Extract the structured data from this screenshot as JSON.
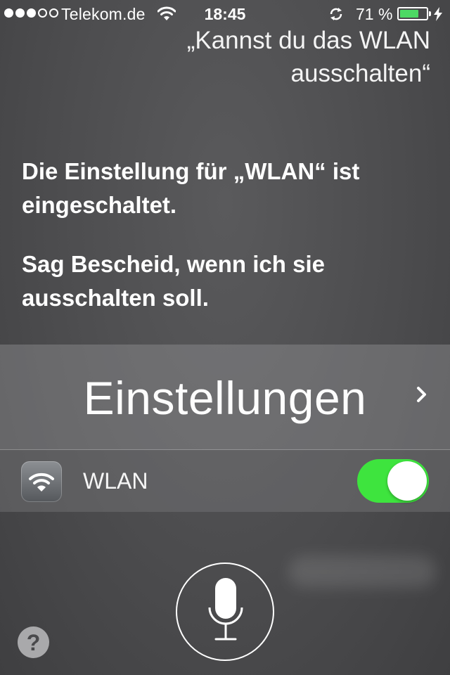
{
  "status_bar": {
    "carrier": "Telekom.de",
    "time": "18:45",
    "battery_percent": "71 %",
    "battery_level": 0.71,
    "signal_strength": 3,
    "signal_max": 5,
    "icons": [
      "wifi-icon",
      "sync-icon",
      "battery-icon",
      "charging-icon"
    ]
  },
  "query": {
    "text": "„Kannst du das WLAN ausschalten“"
  },
  "reply": {
    "line1": "Die Einstellung für „WLAN“ ist eingeschaltet.",
    "line2": "Sag Bescheid, wenn ich sie ausschalten soll."
  },
  "settings_card": {
    "title": "Einstellungen",
    "wlan_label": "WLAN",
    "wlan_enabled": true,
    "icons": [
      "wifi-app-icon",
      "chevron-right-icon"
    ]
  },
  "bottom": {
    "help_label": "?",
    "icons": [
      "microphone-icon"
    ]
  },
  "colors": {
    "toggle_on": "#3ee43e",
    "battery_fill": "#4cd964"
  }
}
